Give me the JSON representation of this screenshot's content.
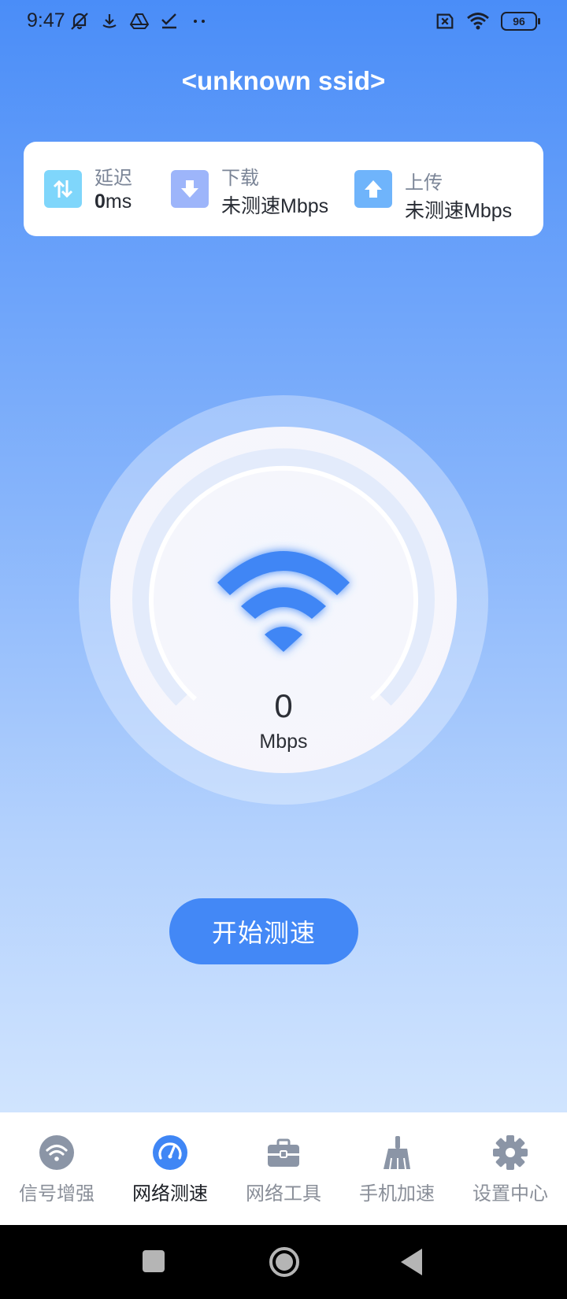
{
  "status_bar": {
    "time": "9:47",
    "icons_left": [
      "mute-bell-icon",
      "download-icon",
      "drive-icon",
      "task-icon",
      "more-dots-icon"
    ],
    "icons_right": [
      "sim-off-icon",
      "wifi-icon",
      "battery-icon"
    ],
    "battery": "96"
  },
  "header": {
    "ssid": "<unknown ssid>"
  },
  "stats": {
    "latency": {
      "label": "延迟",
      "value_num": "0",
      "value_unit": "ms",
      "icon": "latency-arrows-icon",
      "color": "#7fd6fb"
    },
    "download": {
      "label": "下载",
      "value": "未测速Mbps",
      "icon": "download-arrow-icon",
      "color": "#9db5fa"
    },
    "upload": {
      "label": "上传",
      "value": "未测速Mbps",
      "icon": "upload-arrow-icon",
      "color": "#6fb4fb"
    }
  },
  "gauge": {
    "speed": "0",
    "unit": "Mbps",
    "icon": "wifi-icon",
    "accent": "#3f86f5"
  },
  "start_button": {
    "label": "开始测速"
  },
  "bottom_nav": [
    {
      "label": "信号增强",
      "icon": "wifi-signal-icon",
      "active": false
    },
    {
      "label": "网络测速",
      "icon": "speedometer-icon",
      "active": true
    },
    {
      "label": "网络工具",
      "icon": "toolbox-icon",
      "active": false
    },
    {
      "label": "手机加速",
      "icon": "broom-icon",
      "active": false
    },
    {
      "label": "设置中心",
      "icon": "gear-icon",
      "active": false
    }
  ],
  "system_nav": [
    "recents-icon",
    "home-icon",
    "back-icon"
  ]
}
